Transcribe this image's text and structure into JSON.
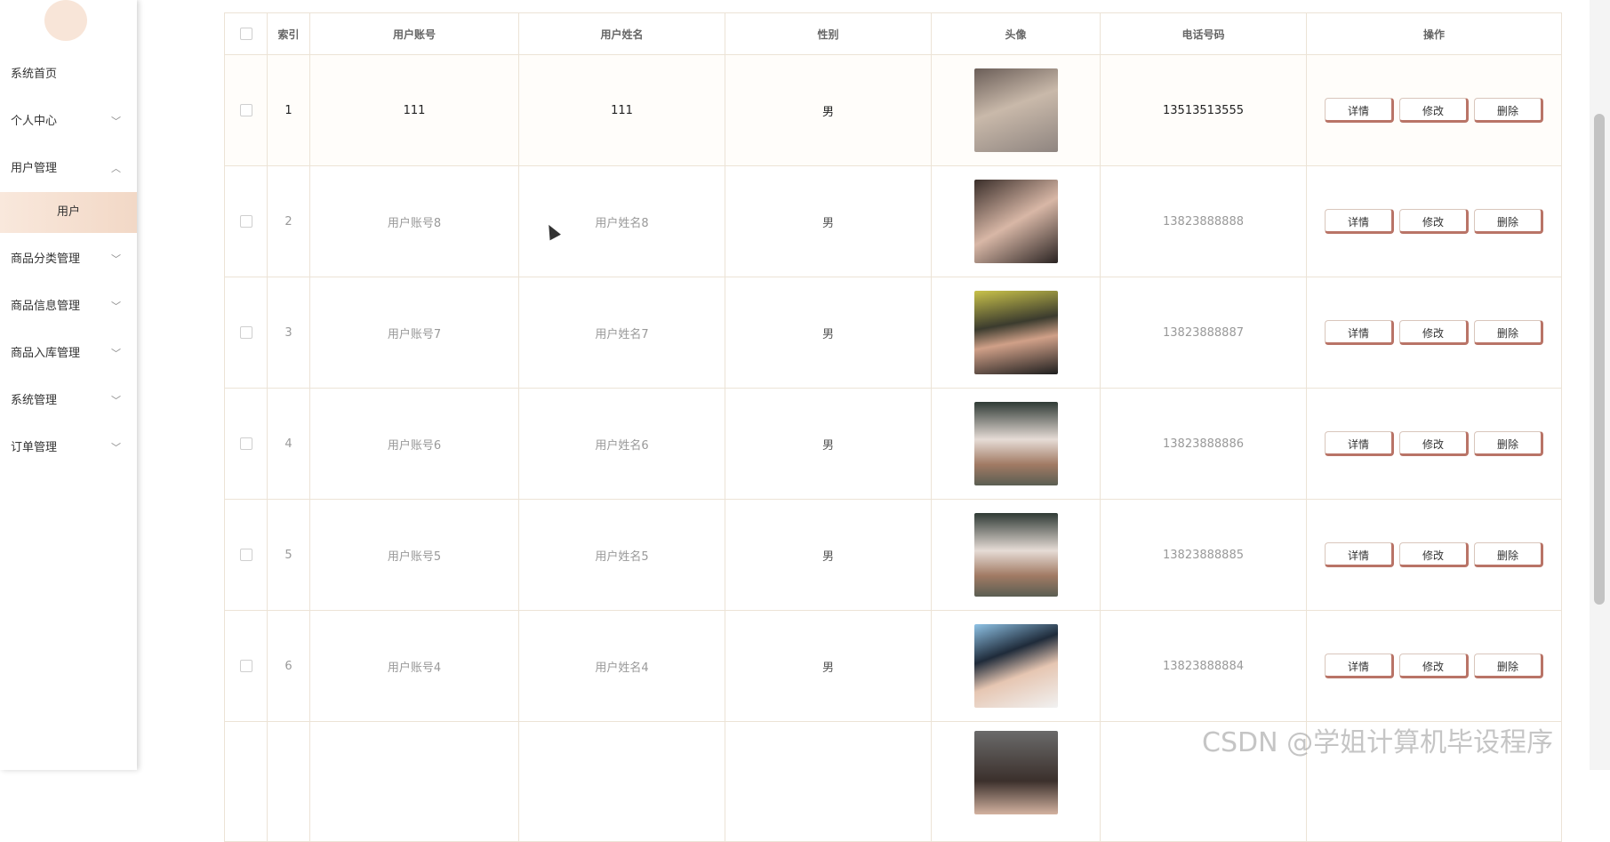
{
  "sidebar": {
    "items": [
      {
        "label": "系统首页",
        "chevron": ""
      },
      {
        "label": "个人中心",
        "chevron": "﹀"
      },
      {
        "label": "用户管理",
        "chevron": "︿"
      },
      {
        "label": "商品分类管理",
        "chevron": "﹀"
      },
      {
        "label": "商品信息管理",
        "chevron": "﹀"
      },
      {
        "label": "商品入库管理",
        "chevron": "﹀"
      },
      {
        "label": "系统管理",
        "chevron": "﹀"
      },
      {
        "label": "订单管理",
        "chevron": "﹀"
      }
    ],
    "sub_item": "用户"
  },
  "table": {
    "headers": [
      "索引",
      "用户账号",
      "用户姓名",
      "性别",
      "头像",
      "电话号码",
      "操作"
    ],
    "rows": [
      {
        "idx": "1",
        "account": "111",
        "name": "111",
        "gender": "男",
        "phone": "13513513555"
      },
      {
        "idx": "2",
        "account": "用户账号8",
        "name": "用户姓名8",
        "gender": "男",
        "phone": "13823888888"
      },
      {
        "idx": "3",
        "account": "用户账号7",
        "name": "用户姓名7",
        "gender": "男",
        "phone": "13823888887"
      },
      {
        "idx": "4",
        "account": "用户账号6",
        "name": "用户姓名6",
        "gender": "男",
        "phone": "13823888886"
      },
      {
        "idx": "5",
        "account": "用户账号5",
        "name": "用户姓名5",
        "gender": "男",
        "phone": "13823888885"
      },
      {
        "idx": "6",
        "account": "用户账号4",
        "name": "用户姓名4",
        "gender": "男",
        "phone": "13823888884"
      }
    ],
    "actions": {
      "detail": "详情",
      "edit": "修改",
      "delete": "删除"
    }
  },
  "watermark": "CSDN @学姐计算机毕设程序",
  "colors": {
    "accent": "#b97467",
    "highlight": "#f2d8c6",
    "border": "#ece3d6"
  }
}
